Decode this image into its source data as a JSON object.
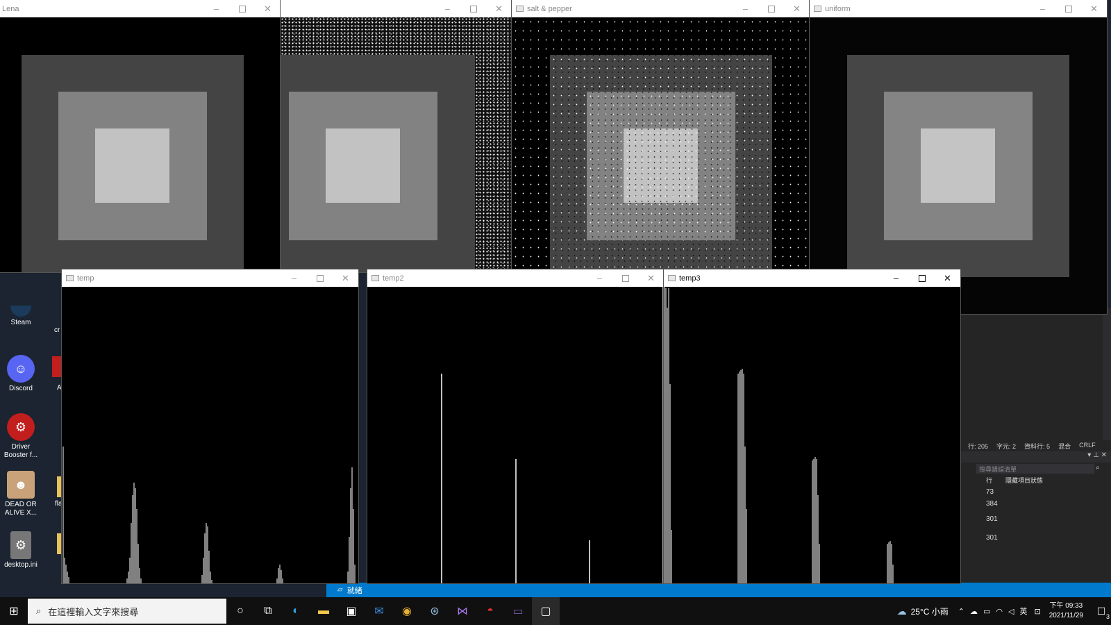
{
  "windows": {
    "lena": {
      "title": "Lena"
    },
    "w2": {
      "title": ""
    },
    "saltpepper": {
      "title": "salt & pepper"
    },
    "uniform": {
      "title": "uniform"
    },
    "temp": {
      "title": "temp"
    },
    "temp2": {
      "title": "temp2"
    },
    "temp3": {
      "title": "temp3"
    }
  },
  "desktop_icons": [
    {
      "label": "Steam",
      "icon": "steam-icon"
    },
    {
      "label": "Discord",
      "icon": "discord-icon"
    },
    {
      "label": "Driver Booster f...",
      "icon": "driver-booster-icon"
    },
    {
      "label": "DEAD OR ALIVE X...",
      "icon": "game-icon"
    },
    {
      "label": "desktop.ini",
      "icon": "ini-file-icon"
    }
  ],
  "partial_icons": {
    "cr": "cr",
    "a": "A",
    "fla": "fla"
  },
  "editor": {
    "status_row": "行: 205",
    "status_col": "字元: 2",
    "status_datarow": "資料行: 5",
    "status_mixed": "混合",
    "status_crlf": "CRLF",
    "search_placeholder": "搜尋錯誤清單",
    "col_row": "行",
    "col_suppress": "隱藏項目狀態",
    "rows": [
      "73",
      "384",
      "301",
      "301"
    ],
    "ready": "就緒"
  },
  "taskbar": {
    "search_placeholder": "在這裡輸入文字來搜尋",
    "weather": "25°C 小雨",
    "ime": "英",
    "time": "下午 09:33",
    "date": "2021/11/29",
    "notifications": "3"
  },
  "colors": {
    "status_blue": "#007acc",
    "editor_bg": "#252526"
  }
}
